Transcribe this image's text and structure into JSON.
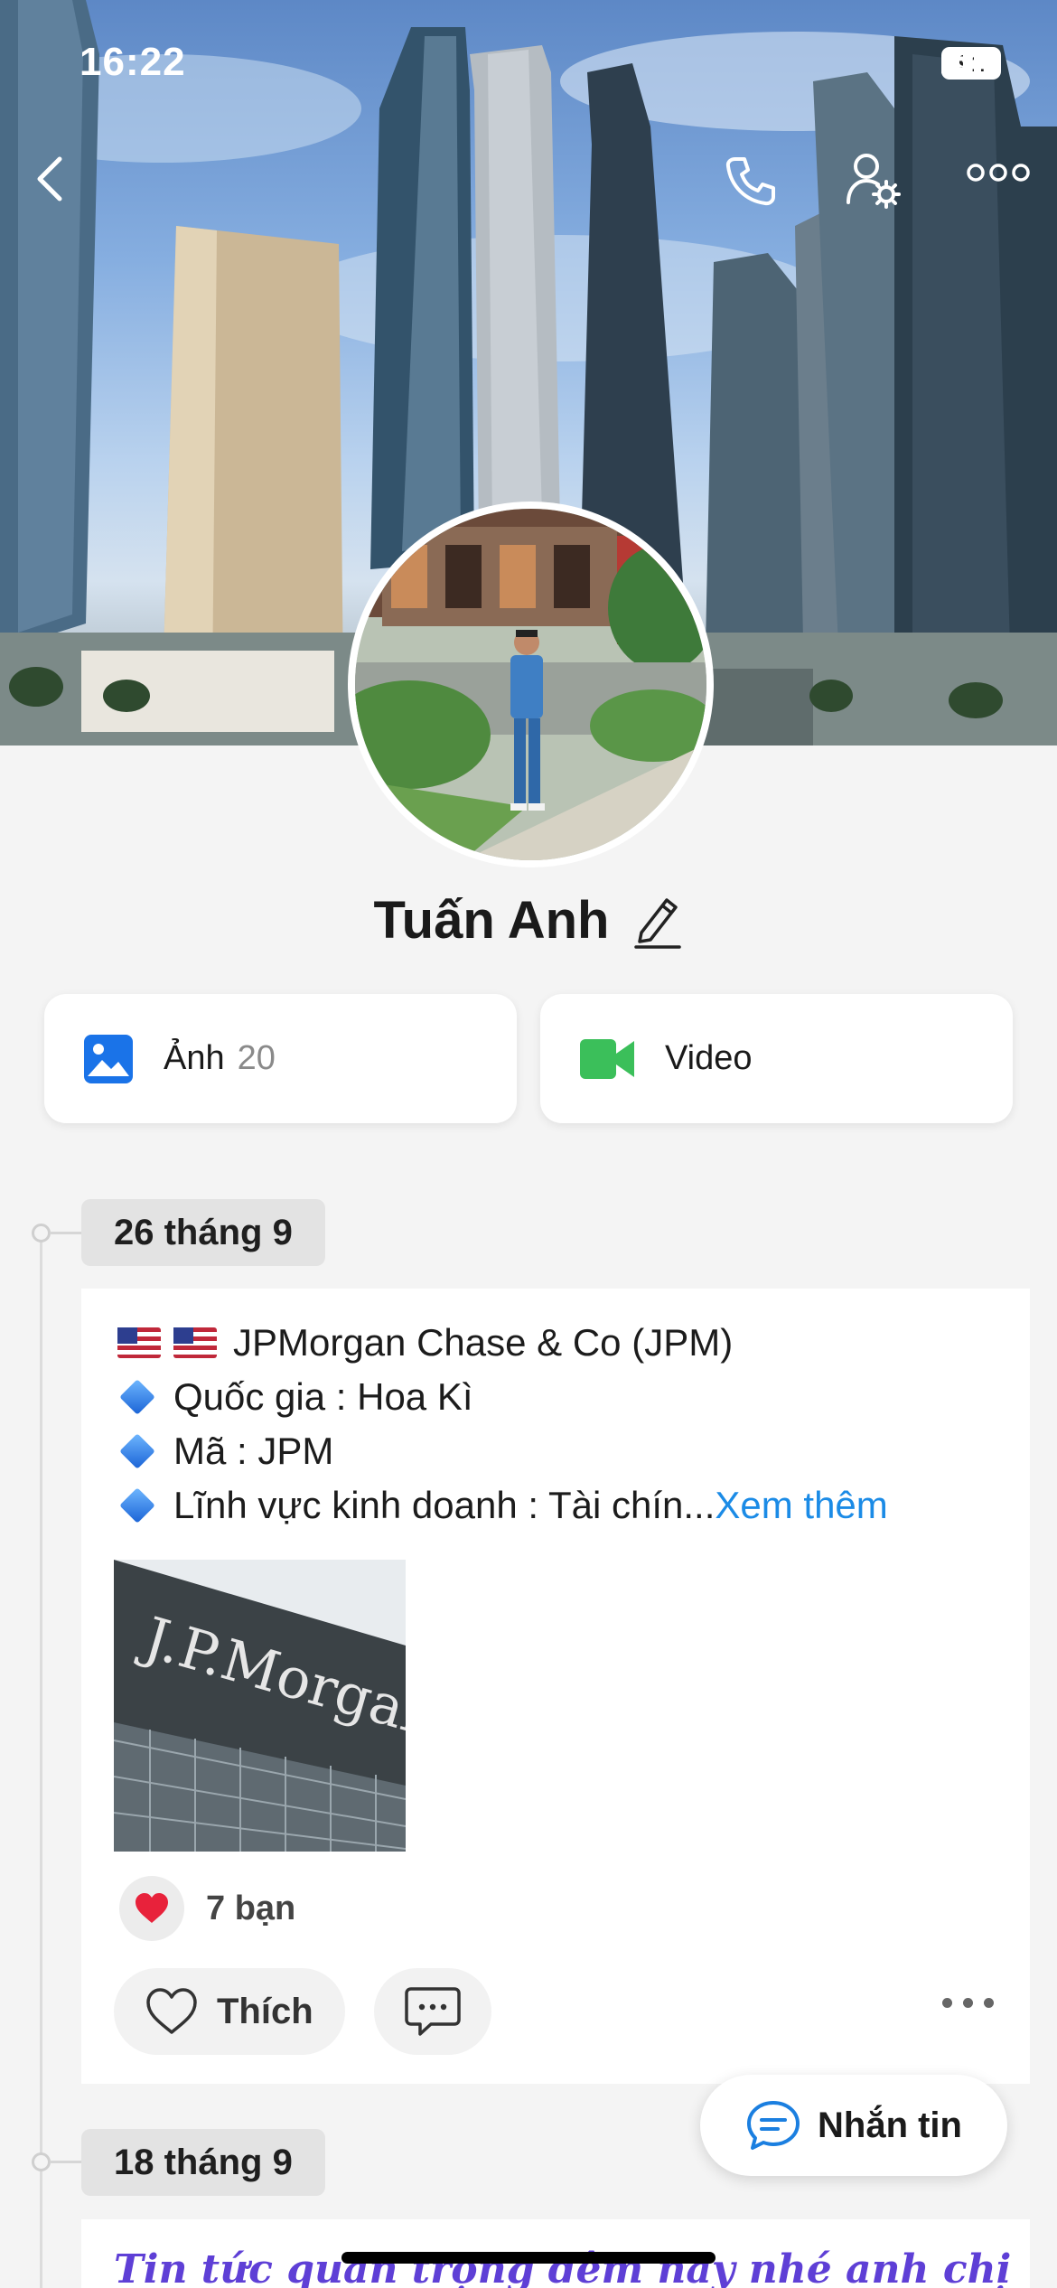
{
  "status_bar": {
    "time": "16:22",
    "battery": "91"
  },
  "profile": {
    "name": "Tuấn Anh"
  },
  "media": {
    "photos_label": "Ảnh",
    "photos_count": "20",
    "video_label": "Video"
  },
  "timeline": [
    {
      "date": "26 tháng 9",
      "line1": "JPMorgan Chase & Co (JPM)",
      "line2": "Quốc gia : Hoa Kì",
      "line3": "Mã : JPM",
      "line4": "Lĩnh vực kinh doanh : Tài chín...",
      "see_more": "Xem thêm",
      "image_text": "J.P.Morgan",
      "reaction_count": "7 bạn",
      "like_label": "Thích"
    },
    {
      "date": "18 tháng 9",
      "text": "Tin tức quan trọng đêm nay nhé anh chị"
    }
  ],
  "message_button": "Nhắn tin",
  "colors": {
    "accent": "#1b8be6",
    "photo_icon": "#1a73e8",
    "video_icon": "#3bbf5a",
    "heart": "#e8223b"
  },
  "icons": [
    "back-icon",
    "phone-icon",
    "user-settings-icon",
    "more-icon",
    "edit-icon",
    "photo-icon",
    "video-icon",
    "heart-icon",
    "comment-icon",
    "message-icon"
  ]
}
